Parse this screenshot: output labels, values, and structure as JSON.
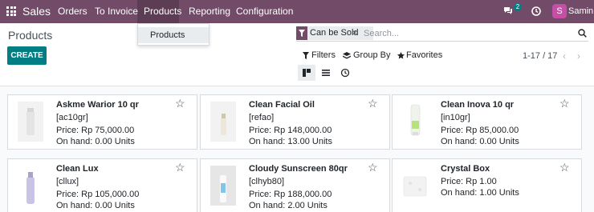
{
  "navbar": {
    "brand": "Sales",
    "menus": [
      "Orders",
      "To Invoice",
      "Products",
      "Reporting",
      "Configuration"
    ],
    "active_menu": "Products",
    "message_count": "2",
    "user_initial": "S",
    "user_name": "Samin"
  },
  "dropdown": {
    "items": [
      "Products"
    ]
  },
  "control_panel": {
    "title": "Products",
    "create_label": "CREATE",
    "search": {
      "facet": "Can be Sold",
      "facet_remove": "×",
      "placeholder": "Search..."
    },
    "filters_label": "Filters",
    "group_by_label": "Group By",
    "favorites_label": "Favorites",
    "pager": "1-17 / 17",
    "views": [
      "kanban",
      "list",
      "activity"
    ],
    "active_view": "kanban"
  },
  "products": [
    {
      "name": "Askme Warior 10 qr",
      "ref": "[ac10gr]",
      "price": "Price: Rp 75,000.00",
      "on_hand": "On hand: 0.00 Units"
    },
    {
      "name": "Clean Facial Oil",
      "ref": "[refao]",
      "price": "Price: Rp 148,000.00",
      "on_hand": "On hand: 13.00 Units"
    },
    {
      "name": "Clean Inova 10 qr",
      "ref": "[in10gr]",
      "price": "Price: Rp 85,000.00",
      "on_hand": "On hand: 0.00 Units"
    },
    {
      "name": "Clean Lux",
      "ref": "[cllux]",
      "price": "Price: Rp 105,000.00",
      "on_hand": "On hand: 0.00 Units"
    },
    {
      "name": "Cloudy Sunscreen 80qr",
      "ref": "[clhyb80]",
      "price": "Price: Rp 188,000.00",
      "on_hand": "On hand: 2.00 Units"
    },
    {
      "name": "Crystal Box",
      "ref": "",
      "price": "Price: Rp 1.00",
      "on_hand": "On hand: 1.00 Units"
    }
  ],
  "colors": {
    "navbar": "#714B67",
    "primary": "#017e84"
  }
}
